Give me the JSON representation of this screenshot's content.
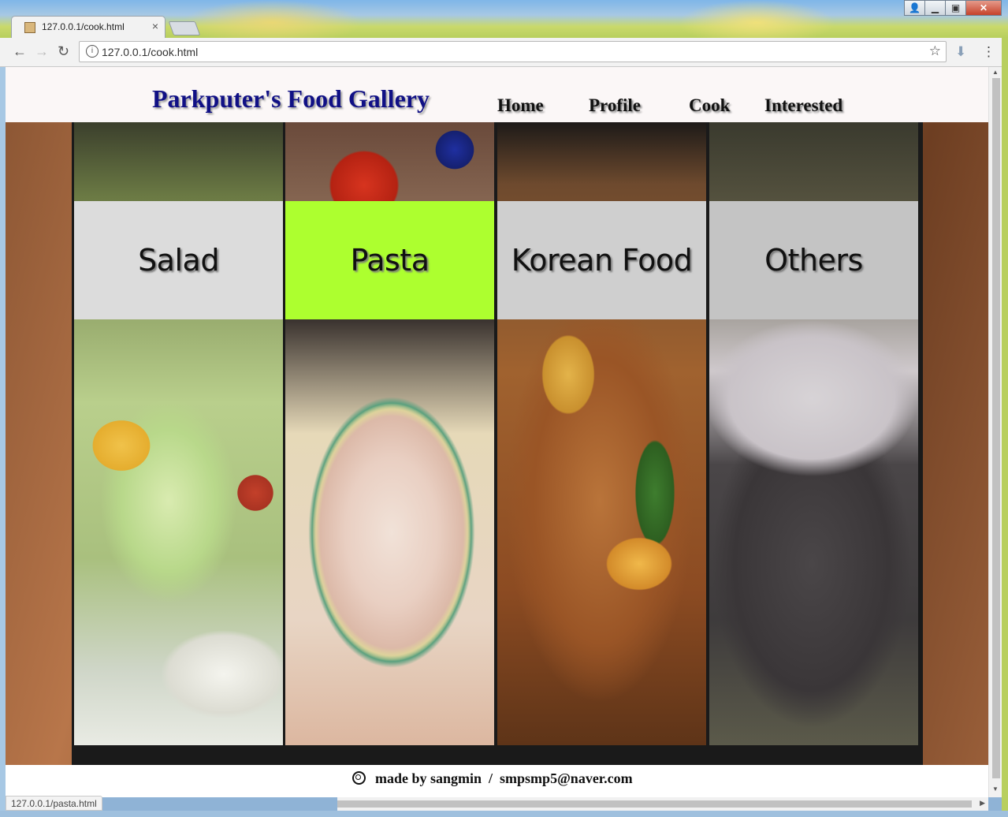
{
  "browser": {
    "tab_title": "127.0.0.1/cook.html",
    "tab_close": "×",
    "url": "127.0.0.1/cook.html",
    "status_url": "127.0.0.1/pasta.html",
    "back": "←",
    "forward": "→",
    "reload": "↻",
    "info": "i",
    "star": "☆",
    "menu": "⋮",
    "download": "⬇"
  },
  "window_buttons": {
    "user": "👤",
    "minimize": "▁",
    "maximize": "▣",
    "close": "✕"
  },
  "page": {
    "title": "Parkputer's Food Gallery",
    "nav": [
      "Home",
      "Profile",
      "Cook",
      "Interested"
    ],
    "panels": [
      {
        "label": "Salad",
        "label_bg": "#dcdcdc",
        "hovered": false
      },
      {
        "label": "Pasta",
        "label_bg": "#adff2f",
        "hovered": true
      },
      {
        "label": "Korean Food",
        "label_bg": "#cfcfcf",
        "hovered": false
      },
      {
        "label": "Others",
        "label_bg": "#c4c4c4",
        "hovered": false
      }
    ],
    "footer": {
      "made_by": "made by sangmin",
      "separator": "/",
      "email": "smpsmp5@naver.com"
    }
  },
  "colors": {
    "title": "#101085",
    "highlight": "#adff2f"
  }
}
